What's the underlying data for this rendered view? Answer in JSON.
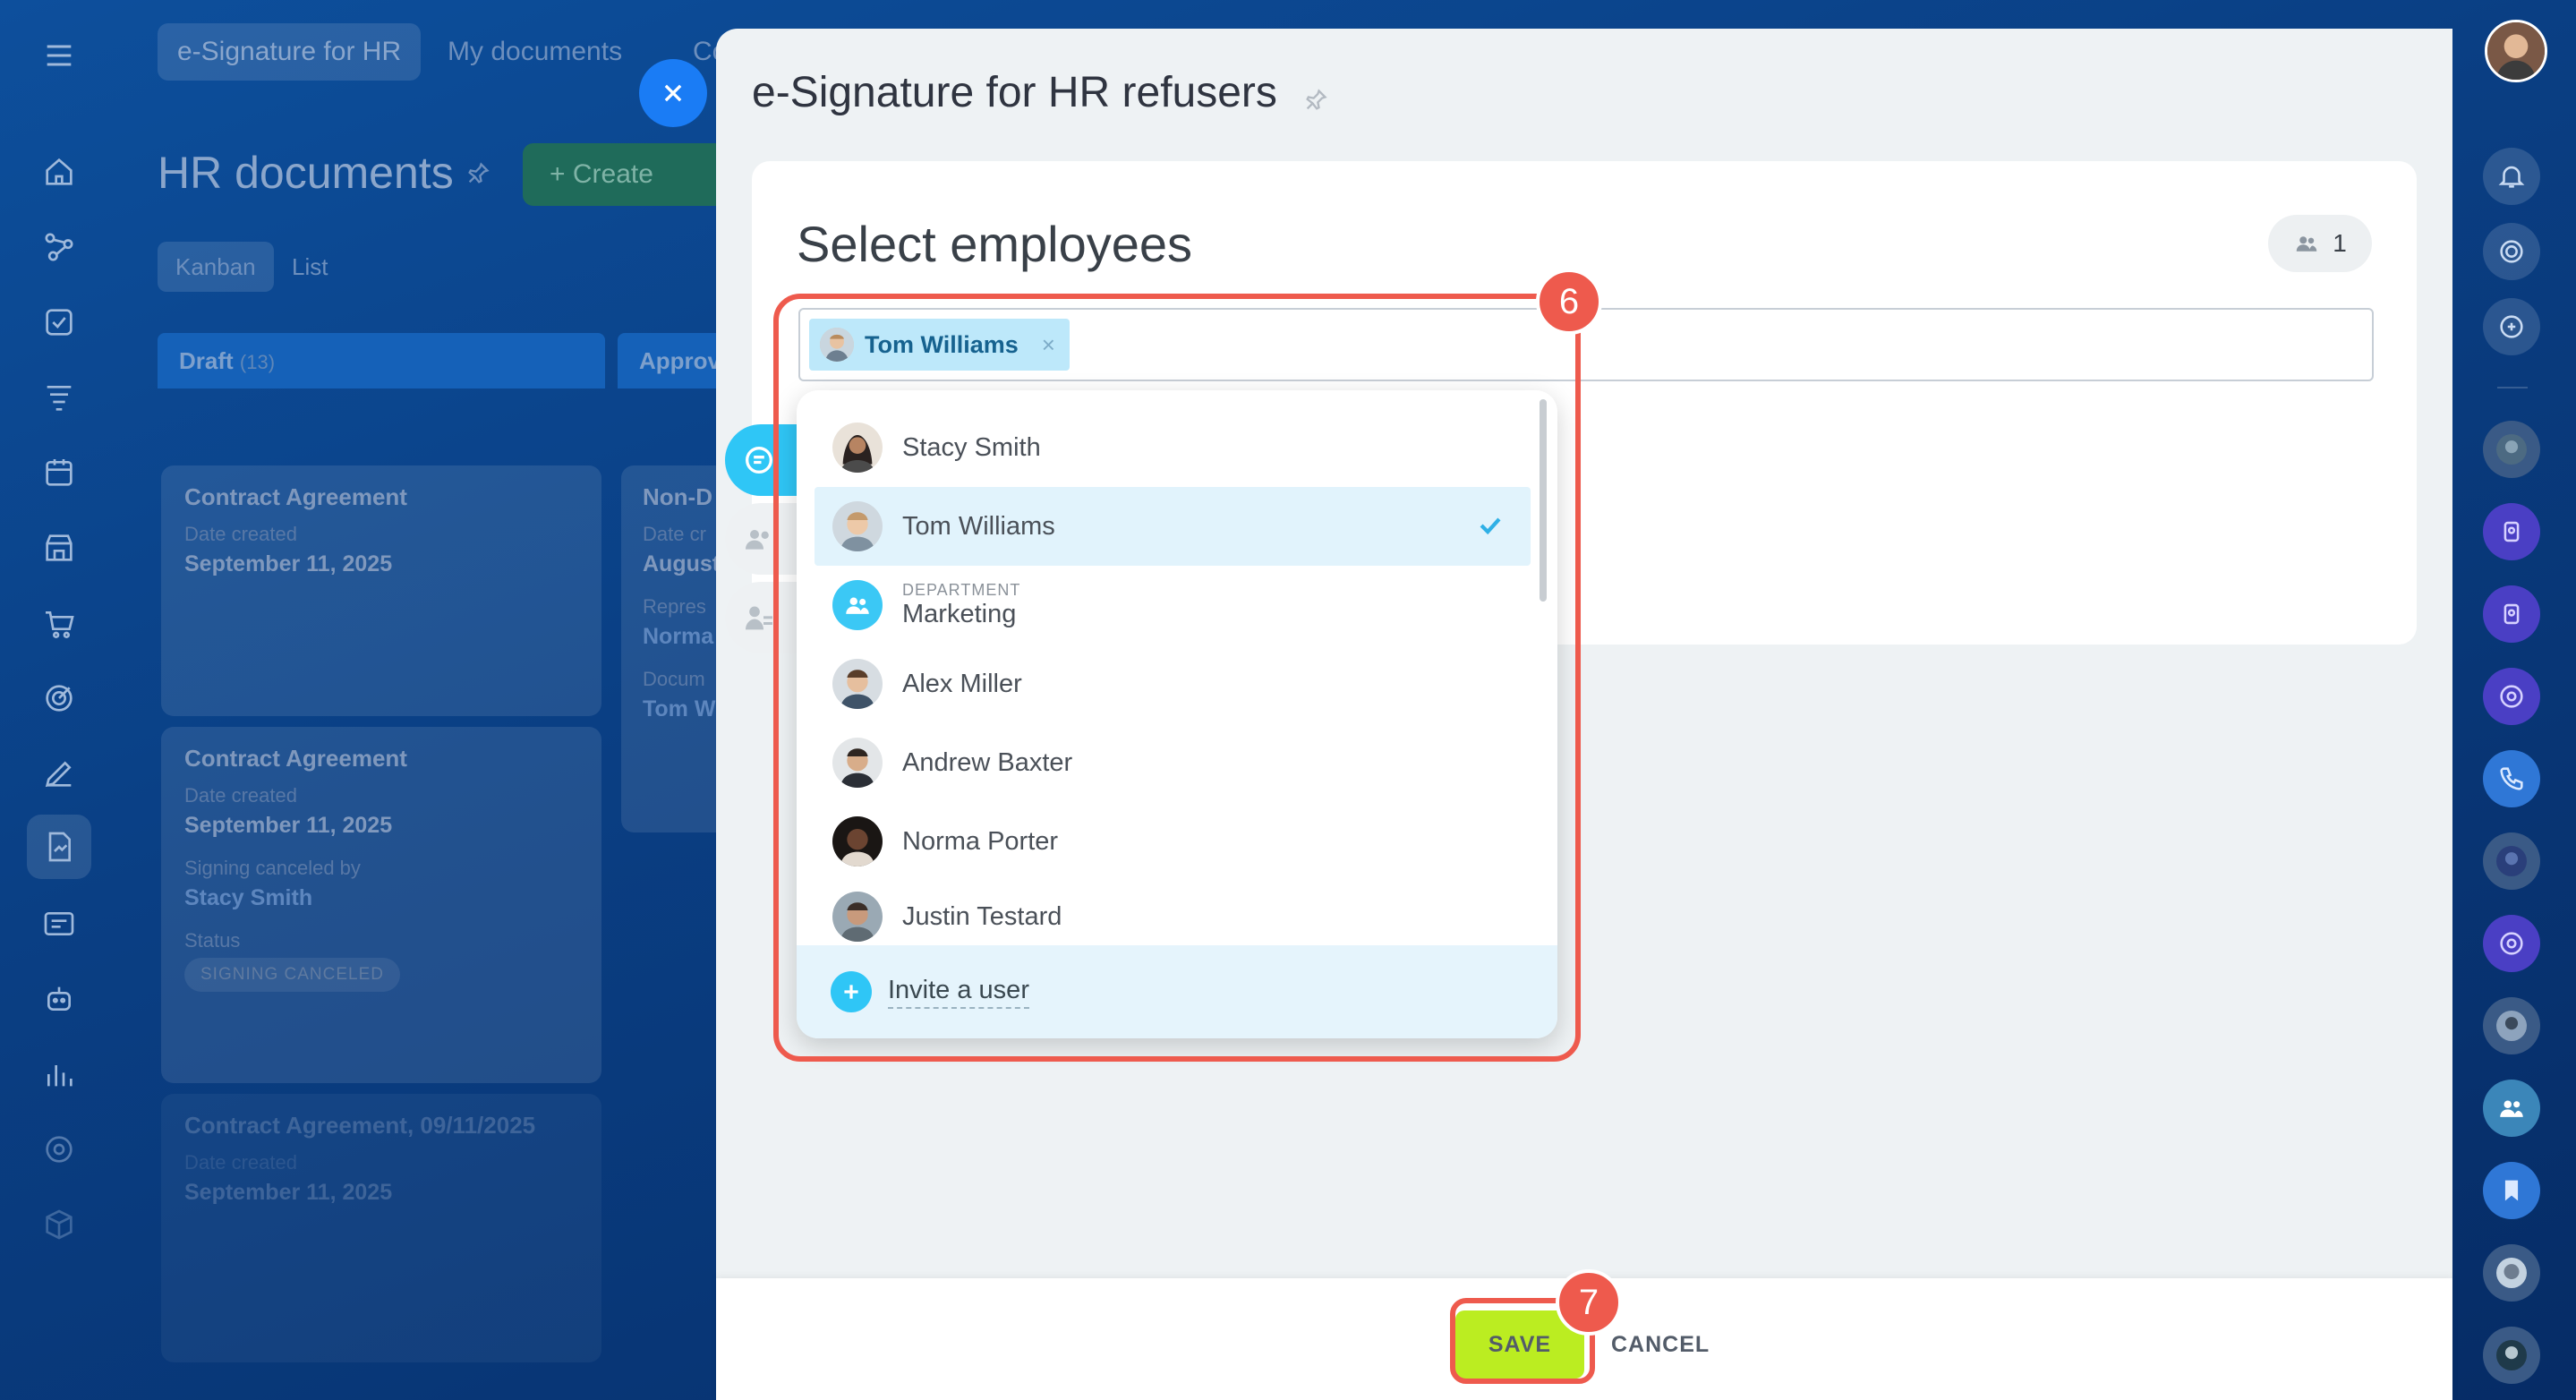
{
  "background_app": {
    "tabs": [
      {
        "label": "e-Signature for HR"
      },
      {
        "label": "My documents"
      },
      {
        "label": "Cor"
      }
    ],
    "page_title": "HR documents",
    "create_button": "Create",
    "view_tabs": [
      {
        "label": "Kanban"
      },
      {
        "label": "List"
      }
    ],
    "columns": [
      {
        "name": "Draft",
        "count": "(13)"
      },
      {
        "name": "Approv"
      }
    ],
    "cards": [
      {
        "title": "Contract Agreement",
        "date_label": "Date created",
        "date": "September 11, 2025"
      },
      {
        "title": "Contract Agreement",
        "date_label": "Date created",
        "date": "September 11, 2025",
        "canceled_label": "Signing canceled by",
        "canceled_by": "Stacy Smith",
        "status_label": "Status",
        "status": "SIGNING CANCELED"
      },
      {
        "title": "Contract Agreement, 09/11/2025",
        "date_label": "Date created",
        "date": "September 11, 2025"
      },
      {
        "title": "Non-D (NDA)",
        "date_label": "Date cr",
        "date": "August",
        "rep_label": "Repres",
        "rep": "Norma",
        "doc_label": "Docum",
        "doc": "Tom W"
      }
    ]
  },
  "slider": {
    "title": "e-Signature for HR refusers",
    "section_title": "Select employees",
    "selected_count": "1",
    "selected_tags": [
      {
        "name": "Tom Williams"
      }
    ],
    "dropdown": {
      "items": [
        {
          "name": "Stacy Smith",
          "type": "user",
          "selected": false
        },
        {
          "name": "Tom Williams",
          "type": "user",
          "selected": true
        },
        {
          "name": "Marketing",
          "type": "department",
          "type_label": "DEPARTMENT",
          "selected": false
        },
        {
          "name": "Alex Miller",
          "type": "user",
          "selected": false
        },
        {
          "name": "Andrew Baxter",
          "type": "user",
          "selected": false
        },
        {
          "name": "Norma Porter",
          "type": "user",
          "selected": false
        },
        {
          "name": "Justin Testard",
          "type": "user",
          "selected": false
        }
      ],
      "invite_label": "Invite a user"
    }
  },
  "footer": {
    "save_label": "SAVE",
    "cancel_label": "CANCEL"
  },
  "annotations": [
    {
      "number": "6"
    },
    {
      "number": "7"
    }
  ],
  "colors": {
    "accent": "#2fc6f6",
    "save": "#bbed21",
    "highlight": "#ee5a4d",
    "selected_row": "#e1f3fc"
  }
}
